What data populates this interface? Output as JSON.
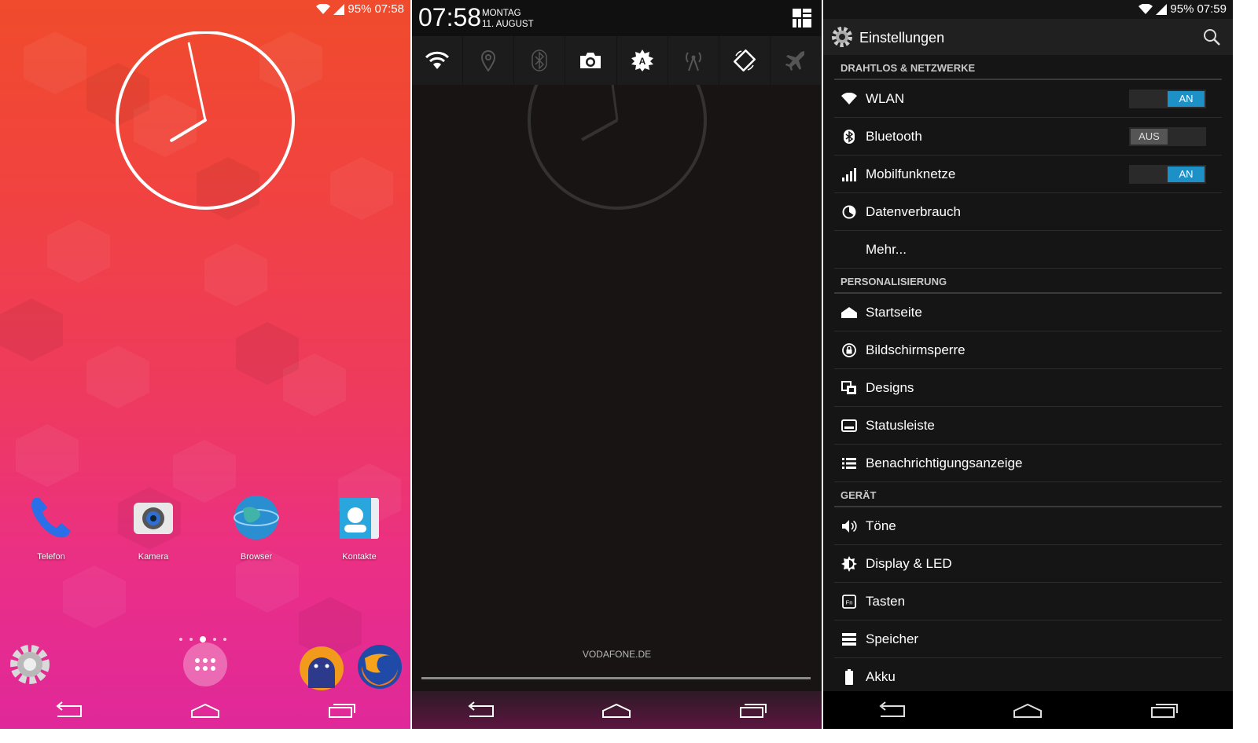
{
  "home": {
    "status": {
      "battery": "95%",
      "time": "07:58"
    },
    "apps": [
      {
        "label": "Telefon",
        "icon": "phone-icon"
      },
      {
        "label": "Kamera",
        "icon": "camera-icon"
      },
      {
        "label": "Browser",
        "icon": "globe-icon"
      },
      {
        "label": "Kontakte",
        "icon": "contacts-icon"
      }
    ],
    "dock": [
      "settings-icon",
      "app-drawer-icon",
      "android-icon",
      "firefox-icon"
    ],
    "clock": {
      "hour": 7,
      "minute": 58
    }
  },
  "shade": {
    "time": "07:58",
    "day": "MONTAG",
    "date": "11. AUGUST",
    "tiles": [
      {
        "icon": "wifi-icon",
        "active": true
      },
      {
        "icon": "location-icon",
        "active": false
      },
      {
        "icon": "bluetooth-icon",
        "active": false
      },
      {
        "icon": "camera-icon",
        "active": true
      },
      {
        "icon": "auto-brightness-icon",
        "active": true
      },
      {
        "icon": "mobile-data-icon",
        "active": false
      },
      {
        "icon": "rotation-icon",
        "active": true
      },
      {
        "icon": "airplane-icon",
        "active": false
      }
    ],
    "carrier": "VODAFONE.DE"
  },
  "settings": {
    "status": {
      "battery": "95%",
      "time": "07:59"
    },
    "title": "Einstellungen",
    "sections": {
      "wireless": "DRAHTLOS & NETZWERKE",
      "personal": "PERSONALISIERUNG",
      "device": "GERÄT"
    },
    "items": {
      "wlan": "WLAN",
      "bluetooth": "Bluetooth",
      "mobile": "Mobilfunknetze",
      "data": "Datenverbrauch",
      "more": "Mehr...",
      "home": "Startseite",
      "lock": "Bildschirmsperre",
      "themes": "Designs",
      "statusbar": "Statusleiste",
      "notif": "Benachrichtigungsanzeige",
      "sound": "Töne",
      "display": "Display & LED",
      "keys": "Tasten",
      "storage": "Speicher",
      "battery": "Akku"
    },
    "toggles": {
      "wlan": "AN",
      "bluetooth": "AUS",
      "mobile": "AN"
    }
  }
}
